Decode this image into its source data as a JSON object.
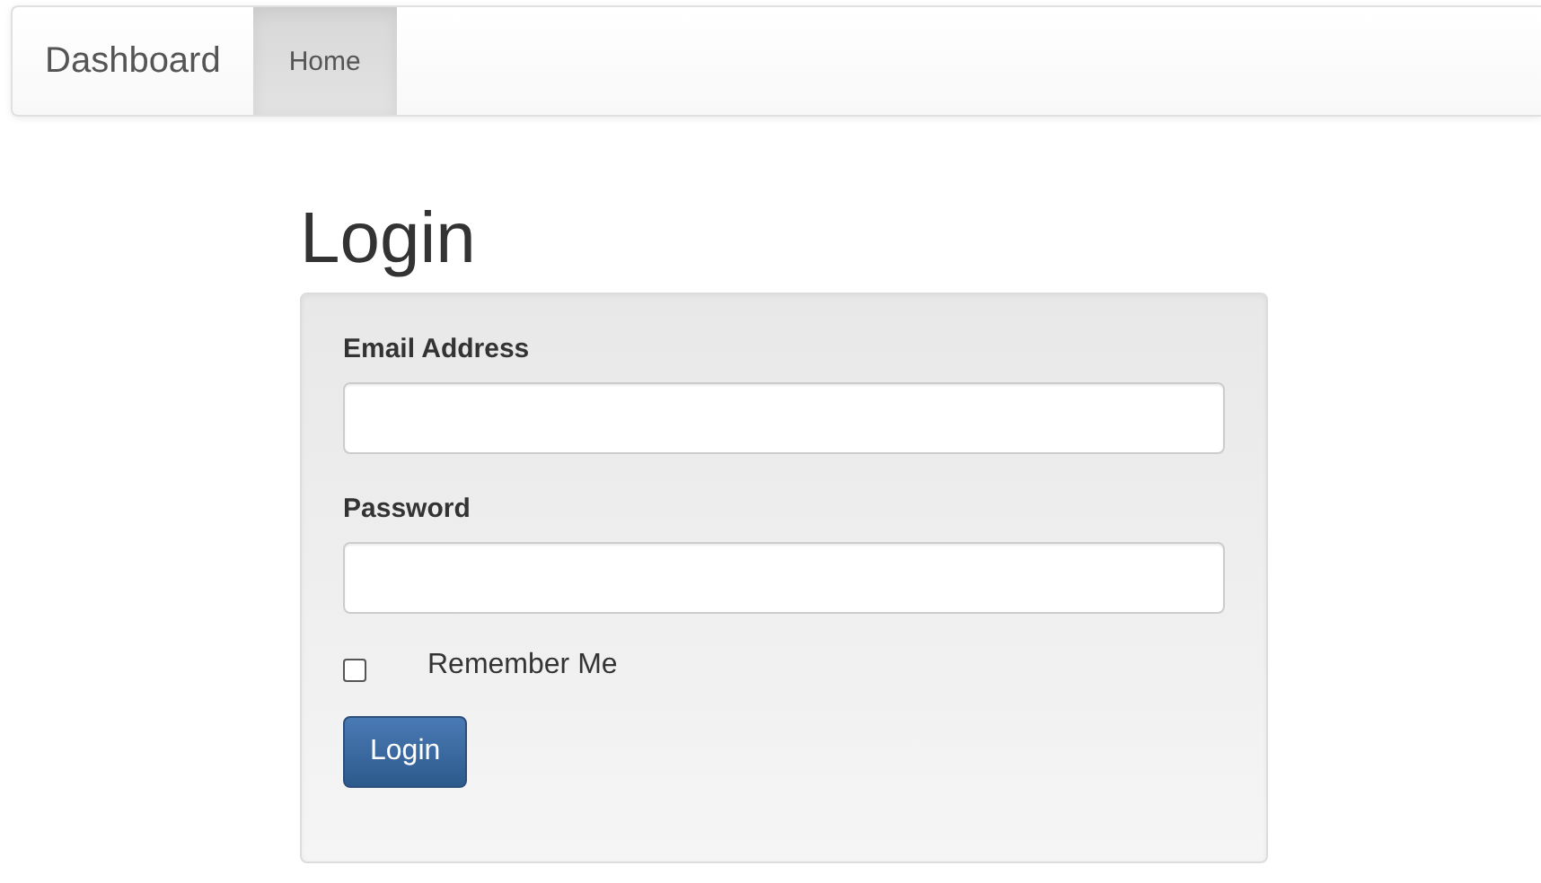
{
  "navbar": {
    "brand": "Dashboard",
    "items": [
      {
        "label": "Home",
        "selected": true
      }
    ]
  },
  "heading": "Login",
  "form": {
    "fields": [
      {
        "label": "Email Address"
      },
      {
        "label": "Password"
      }
    ],
    "remember": {
      "label": "Remember Me",
      "checked": false
    },
    "button": "Login"
  }
}
